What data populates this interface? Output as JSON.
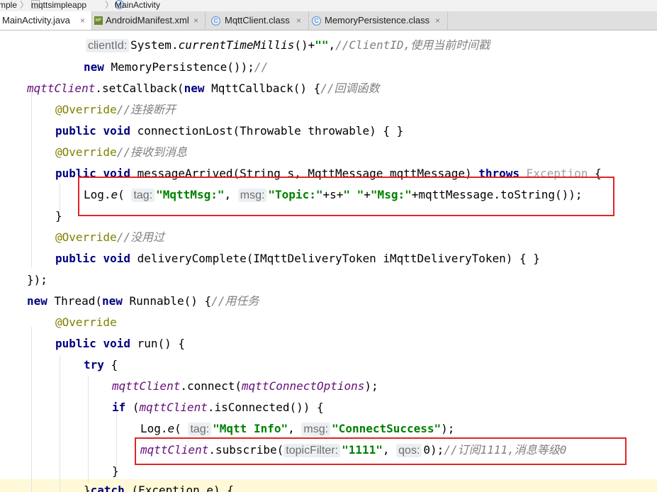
{
  "breadcrumb": {
    "project": "mple",
    "module": "mqttsimpleapp",
    "class_name": "MainActivity"
  },
  "tabs": [
    {
      "label": "MainActivity.java",
      "active": true,
      "icon": "java-class-icon"
    },
    {
      "label": "AndroidManifest.xml",
      "active": false,
      "icon": "manifest-file-icon"
    },
    {
      "label": "MqttClient.class",
      "active": false,
      "icon": "class-file-icon"
    },
    {
      "label": "MemoryPersistence.class",
      "active": false,
      "icon": "class-file-icon"
    }
  ],
  "close_glyph": "×",
  "colors": {
    "keyword": "#000080",
    "string": "#008000",
    "comment": "#808080",
    "field": "#660e7a",
    "annotation": "#808000",
    "highlight_box": "#e02525",
    "caret_line": "#fff9d8"
  },
  "code": {
    "l1": {
      "hint": "clientId:",
      "a": "System.",
      "method": "currentTimeMillis",
      "b": "()+",
      "str": "\"\"",
      "c": ",",
      "comment": "//ClientID,使用当前时间戳"
    },
    "l2": {
      "kw": "new",
      "a": " MemoryPersistence());",
      "comment": "//"
    },
    "l3": {
      "field": "mqttClient",
      "a": ".setCallback(",
      "kw": "new",
      "b": " MqttCallback() {",
      "comment": "//回调函数"
    },
    "l4": {
      "ann": "@Override",
      "comment": "//连接断开"
    },
    "l5": {
      "kw1": "public",
      "kw2": "void",
      "a": " connectionLost(Throwable throwable) { }"
    },
    "l6": {
      "ann": "@Override",
      "comment": "//接收到消息"
    },
    "l7": {
      "kw1": "public",
      "kw2": "void",
      "a": " messageArrived(String s, MqttMessage mqttMessage) ",
      "kw3": "throws",
      "exc": " Exception",
      "b": " {"
    },
    "l8": {
      "a": "Log.",
      "method": "e",
      "b": "(",
      "hint1": "tag:",
      "str1": "\"MqttMsg:\"",
      "c": ", ",
      "hint2": "msg:",
      "str2": "\"Topic:\"",
      "d": "+s+",
      "str3": "\" \"",
      "e": "+",
      "str4": "\"Msg:\"",
      "f": "+mqttMessage.toString());"
    },
    "l9": {
      "a": "}"
    },
    "l10": {
      "ann": "@Override",
      "comment": "//没用过"
    },
    "l11": {
      "kw1": "public",
      "kw2": "void",
      "a": " deliveryComplete(IMqttDeliveryToken iMqttDeliveryToken) { }"
    },
    "l12": {
      "a": "});"
    },
    "l13": {
      "kw1": "new",
      "a": " Thread(",
      "kw2": "new",
      "b": " Runnable() {",
      "comment": "//用任务"
    },
    "l14": {
      "ann": "@Override"
    },
    "l15": {
      "kw1": "public",
      "kw2": "void",
      "a": " run() {"
    },
    "l16": {
      "kw": "try",
      "a": " {"
    },
    "l17": {
      "field1": "mqttClient",
      "a": ".connect(",
      "field2": "mqttConnectOptions",
      "b": ");"
    },
    "l18": {
      "kw": "if",
      "a": " (",
      "field": "mqttClient",
      "b": ".isConnected()) {"
    },
    "l19": {
      "a": "Log.",
      "method": "e",
      "b": "(",
      "hint1": "tag:",
      "str1": "\"Mqtt Info\"",
      "c": ", ",
      "hint2": "msg:",
      "str2": "\"ConnectSuccess\"",
      "d": ");"
    },
    "l20": {
      "field": "mqttClient",
      "a": ".subscribe(",
      "hint1": "topicFilter:",
      "str": "\"1111\"",
      "b": ", ",
      "hint2": "qos:",
      "c": "0);",
      "comment": "//订阅1111,消息等级0"
    },
    "l21": {
      "a": "}"
    },
    "l22": {
      "a": "}",
      "kw": "catch",
      "b": " (Exception e) {"
    }
  }
}
